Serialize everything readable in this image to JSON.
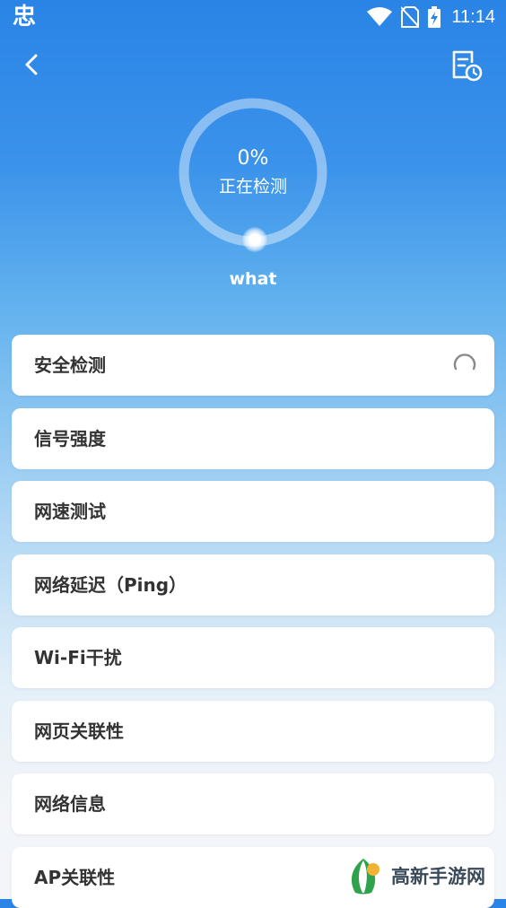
{
  "status_bar": {
    "app_icon_text": "忠",
    "time": "11:14"
  },
  "gauge": {
    "percent": "0%",
    "progress": 0,
    "status": "正在检测"
  },
  "network": {
    "name": "what"
  },
  "checks": [
    {
      "label": "安全检测",
      "loading": true
    },
    {
      "label": "信号强度",
      "loading": false
    },
    {
      "label": "网速测试",
      "loading": false
    },
    {
      "label": "网络延迟（Ping）",
      "loading": false
    },
    {
      "label": "Wi-Fi干扰",
      "loading": false
    },
    {
      "label": "网页关联性",
      "loading": false
    },
    {
      "label": "网络信息",
      "loading": false
    },
    {
      "label": "AP关联性",
      "loading": false
    }
  ],
  "watermark": {
    "text": "高新手游网"
  },
  "icons": {
    "back": "chevron-left-icon",
    "history": "report-clock-icon",
    "spinner": "loading-spinner-icon",
    "wifi": "wifi-icon",
    "no_sim": "no-sim-icon",
    "battery": "battery-charging-icon"
  },
  "colors": {
    "accent": "#2a84e6",
    "card": "#ffffff",
    "text": "#333333"
  }
}
